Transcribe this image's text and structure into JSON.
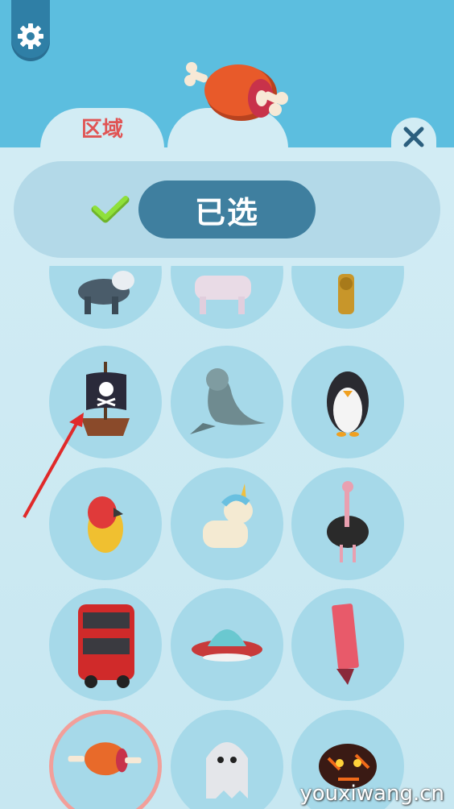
{
  "header": {
    "settings_icon": "gear-icon",
    "tabs": [
      {
        "label": "区域",
        "active": false
      },
      {
        "label": "",
        "icon": "meat-icon",
        "active": true
      }
    ],
    "close_icon": "close-icon"
  },
  "filter": {
    "check_icon": "checkmark-icon",
    "selected_label": "已选"
  },
  "items": [
    {
      "name": "husky-dog"
    },
    {
      "name": "pig"
    },
    {
      "name": "golden-statue"
    },
    {
      "name": "pirate-ship"
    },
    {
      "name": "seal"
    },
    {
      "name": "penguin"
    },
    {
      "name": "parrot"
    },
    {
      "name": "unicorn"
    },
    {
      "name": "ostrich"
    },
    {
      "name": "double-decker-bus"
    },
    {
      "name": "ufo"
    },
    {
      "name": "highlighter-marker"
    },
    {
      "name": "meat",
      "selected": true
    },
    {
      "name": "ghost"
    },
    {
      "name": "lava-monster"
    }
  ],
  "colors": {
    "sky": "#5cbedf",
    "panel": "#d2ecf4",
    "accent_red": "#e05454",
    "pill": "#3f7f9f",
    "check": "#7ed321"
  },
  "watermark": "youxiwang.cn"
}
